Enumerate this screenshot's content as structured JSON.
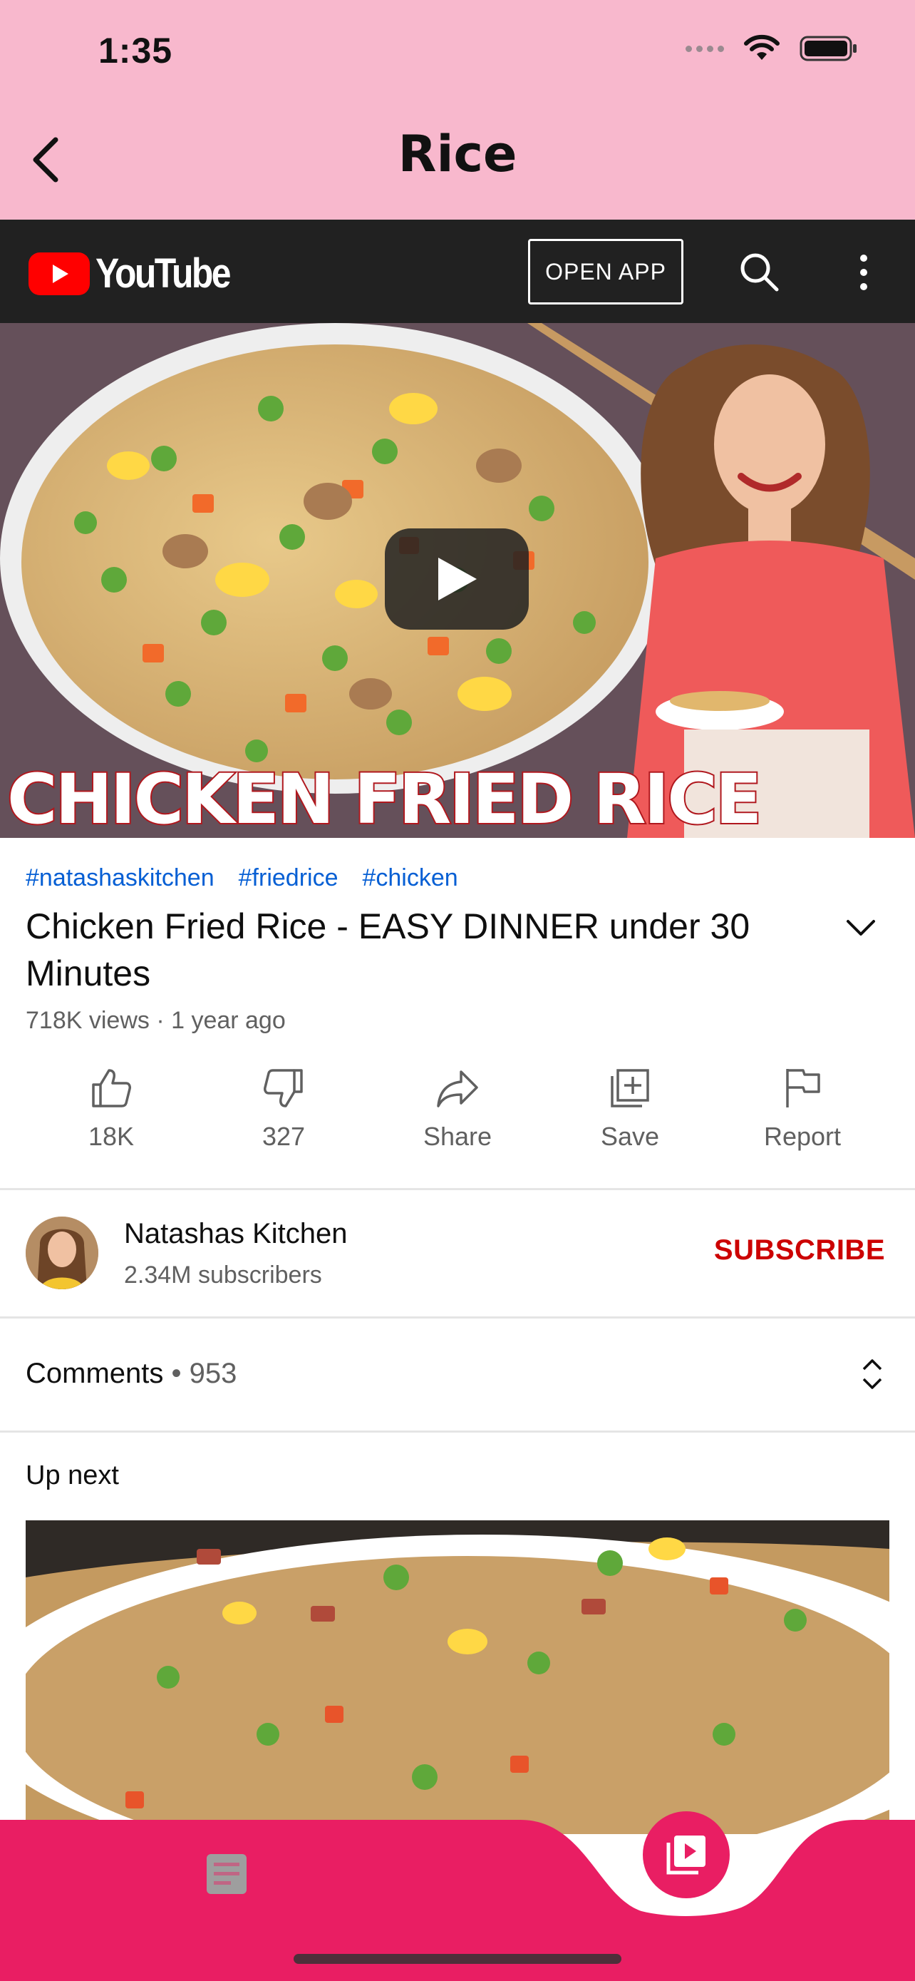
{
  "status_bar": {
    "time": "1:35",
    "icons": [
      "signal-icon",
      "wifi-icon",
      "battery-icon"
    ]
  },
  "header": {
    "title": "Rice",
    "back_icon": "chevron-left-icon"
  },
  "youtube_bar": {
    "logo_text": "YouTube",
    "open_app_label": "OPEN APP",
    "icons": [
      "search-icon",
      "more-vert-icon"
    ]
  },
  "video": {
    "thumbnail_caption": "CHICKEN FRIED RICE",
    "hashtags": [
      "#natashaskitchen",
      "#friedrice",
      "#chicken"
    ],
    "title": "Chicken Fried Rice - EASY DINNER under 30 Minutes",
    "meta": "718K views · 1 year ago"
  },
  "actions": [
    {
      "icon": "thumb-up-icon",
      "label": "18K"
    },
    {
      "icon": "thumb-down-icon",
      "label": "327"
    },
    {
      "icon": "share-icon",
      "label": "Share"
    },
    {
      "icon": "save-icon",
      "label": "Save"
    },
    {
      "icon": "flag-icon",
      "label": "Report"
    }
  ],
  "channel": {
    "name": "Natashas Kitchen",
    "subscribers": "2.34M subscribers",
    "subscribe_label": "SUBSCRIBE"
  },
  "comments": {
    "label": "Comments",
    "separator": " • ",
    "count": "953"
  },
  "up_next": {
    "label": "Up next"
  },
  "bottom_nav": {
    "items": [
      "article-icon",
      "video-library-icon"
    ]
  },
  "colors": {
    "header_bg": "#f8b8cd",
    "youtube_bar_bg": "#212121",
    "youtube_red": "#ff0000",
    "hashtag_blue": "#065fd4",
    "subscribe_red": "#cc0000",
    "bottom_nav_bg": "#e91e63"
  }
}
